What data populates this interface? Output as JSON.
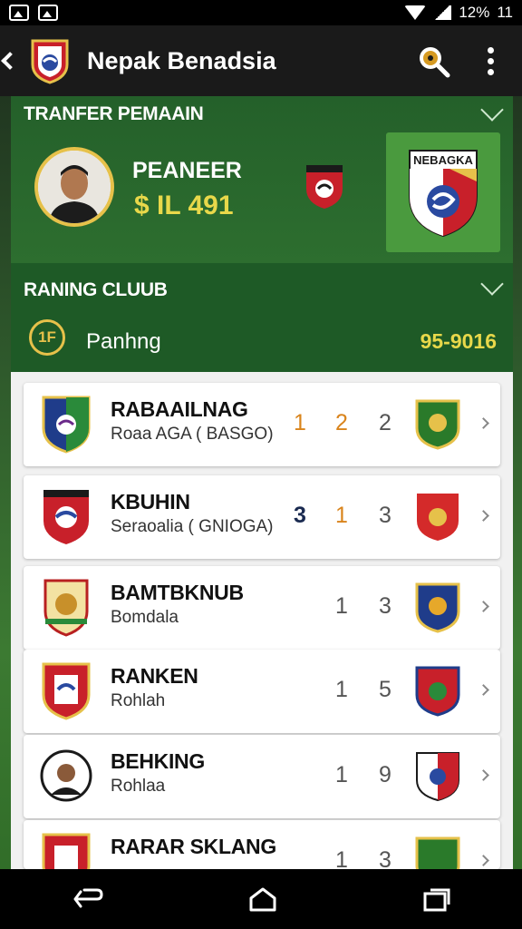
{
  "status_bar": {
    "battery_percent": "12%",
    "time": "11"
  },
  "app_bar": {
    "title": "Nepak Benadsia"
  },
  "transfer": {
    "title": "TRANFER PEMAAIN",
    "player_name": "PEANEER",
    "player_price": "$ IL 491",
    "big_crest_text": "NEBAGKA"
  },
  "ranking": {
    "title": "RANING CLUUB",
    "icon_text": "1F",
    "label": "Panhng",
    "value": "95-9016"
  },
  "clubs": [
    {
      "name": "RABAAILNAG",
      "sub": "Roaa AGA ( BASGO)",
      "s1": "1",
      "s2": "2",
      "s3": "2",
      "s1_color": "#d9841c",
      "s2_color": "#d9841c"
    },
    {
      "name": "KBUHIN",
      "sub": "Seraoalia ( GNIOGA)",
      "s1": "3",
      "s2": "1",
      "s3": "3",
      "s1_color": "#1a2a50",
      "s2_color": "#d9841c"
    },
    {
      "name": "BAMTBKNUB",
      "sub": "Bomdala",
      "s1": "",
      "s2": "1",
      "s3": "3",
      "s1_color": "#555",
      "s2_color": "#555"
    },
    {
      "name": "RANKEN",
      "sub": "Rohlah",
      "s1": "",
      "s2": "1",
      "s3": "5",
      "s1_color": "#555",
      "s2_color": "#555"
    },
    {
      "name": "BEHKING",
      "sub": "Rohlaa",
      "s1": "",
      "s2": "1",
      "s3": "9",
      "s1_color": "#555",
      "s2_color": "#555"
    },
    {
      "name": "RARAR SKLANG",
      "sub": "",
      "s1": "",
      "s2": "1",
      "s3": "3",
      "s1_color": "#555",
      "s2_color": "#555"
    }
  ],
  "colors": {
    "header": "#1a1a1a",
    "transfer_green": "#2d6e2f",
    "accent_gold": "#e8d84a"
  },
  "icons": [
    "image-icon",
    "wifi-icon",
    "signal-icon",
    "back-icon",
    "search-icon",
    "more-icon",
    "nav-back-icon",
    "nav-home-icon",
    "nav-recents-icon"
  ]
}
